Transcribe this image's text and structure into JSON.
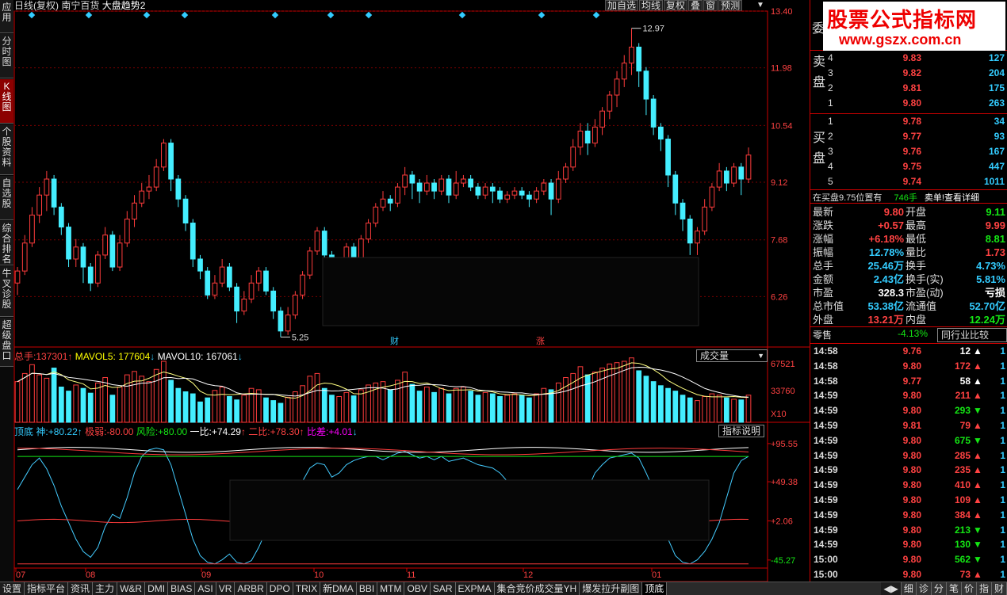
{
  "window": {
    "period": "日线(复权)",
    "stock": "南宁百货",
    "indicator_title": "大盘趋势2"
  },
  "toolbar": [
    "加自选",
    "均线",
    "复权",
    "叠",
    "窗",
    "预测"
  ],
  "left_nav": [
    "应用",
    "分时图",
    "K线图",
    "个股资料",
    "自选股",
    "综合排名",
    "牛叉诊股",
    "超级盘口"
  ],
  "logo": {
    "line1": "股票公式指标网",
    "line2": "www.gszx.com.cn"
  },
  "price_axis": [
    "13.40",
    "11.98",
    "10.54",
    "9.12",
    "7.68",
    "6.26"
  ],
  "markers": {
    "high": "12.97",
    "low": "5.25",
    "cai": "财",
    "zhang": "涨"
  },
  "volume_header": {
    "total_label": "总手:",
    "total": "137301",
    "mavol5_label": "MAVOL5:",
    "mavol5": "177604",
    "mavol10_label": "MAVOL10:",
    "mavol10": "167061",
    "selector": "成交量"
  },
  "volume_axis": [
    "67521",
    "33760",
    "X10"
  ],
  "indicator_header": {
    "name": "顶底",
    "l1": "神:",
    "v1": "+80.22",
    "l2": "极弱:",
    "v2": "-80.00",
    "l3": "风险:",
    "v3": "+80.00",
    "l4": "一比:",
    "v4": "+74.29",
    "l5": "二比:",
    "v5": "+78.30",
    "l6": "比差:",
    "v6": "+4.01",
    "button": "指标说明"
  },
  "indicator_axis": [
    "+95.55",
    "+49.38",
    "+2.06",
    "-45.27"
  ],
  "months": [
    "07",
    "08",
    "09",
    "10",
    "11",
    "12",
    "01"
  ],
  "chart_data": {
    "type": "candlestick",
    "price_range": [
      5.0,
      13.4
    ],
    "candles": [
      [
        6.6,
        6.9,
        6.3,
        7.0
      ],
      [
        6.9,
        7.6,
        6.8,
        7.8
      ],
      [
        7.6,
        8.3,
        7.5,
        8.5
      ],
      [
        8.3,
        8.8,
        8.1,
        9.0
      ],
      [
        8.8,
        9.2,
        8.4,
        9.4
      ],
      [
        9.2,
        8.5,
        8.3,
        9.3
      ],
      [
        8.5,
        8.0,
        7.8,
        8.6
      ],
      [
        8.0,
        7.2,
        7.0,
        8.1
      ],
      [
        7.2,
        7.5,
        7.0,
        7.7
      ],
      [
        7.5,
        7.0,
        6.6,
        7.6
      ],
      [
        7.0,
        6.6,
        6.4,
        7.1
      ],
      [
        6.6,
        7.3,
        6.5,
        7.4
      ],
      [
        7.3,
        7.8,
        7.2,
        8.0
      ],
      [
        7.8,
        7.0,
        6.9,
        7.9
      ],
      [
        7.0,
        7.6,
        6.9,
        7.8
      ],
      [
        7.6,
        8.2,
        7.5,
        8.4
      ],
      [
        8.2,
        8.6,
        8.0,
        8.8
      ],
      [
        8.6,
        8.9,
        8.5,
        9.1
      ],
      [
        8.9,
        9.0,
        8.7,
        9.3
      ],
      [
        9.0,
        9.5,
        8.9,
        9.7
      ],
      [
        9.5,
        10.1,
        9.4,
        10.2
      ],
      [
        10.1,
        9.2,
        8.9,
        10.2
      ],
      [
        9.2,
        8.7,
        8.5,
        9.3
      ],
      [
        8.7,
        8.1,
        7.9,
        8.8
      ],
      [
        8.1,
        7.2,
        7.0,
        8.2
      ],
      [
        7.2,
        6.9,
        6.7,
        7.3
      ],
      [
        6.9,
        6.3,
        6.2,
        7.0
      ],
      [
        6.3,
        6.6,
        6.2,
        6.8
      ],
      [
        6.6,
        7.0,
        6.5,
        7.2
      ],
      [
        7.0,
        6.5,
        6.4,
        7.1
      ],
      [
        6.5,
        5.9,
        5.6,
        6.6
      ],
      [
        5.9,
        6.2,
        5.8,
        6.4
      ],
      [
        6.2,
        6.6,
        6.1,
        6.8
      ],
      [
        6.6,
        6.9,
        6.4,
        7.0
      ],
      [
        6.9,
        6.4,
        6.3,
        7.0
      ],
      [
        6.4,
        5.9,
        5.7,
        6.5
      ],
      [
        5.9,
        5.4,
        5.25,
        6.0
      ],
      [
        5.4,
        5.8,
        5.3,
        6.0
      ],
      [
        5.8,
        6.3,
        5.7,
        6.4
      ],
      [
        6.3,
        6.8,
        6.2,
        6.9
      ],
      [
        6.8,
        7.4,
        6.7,
        7.5
      ],
      [
        7.4,
        7.9,
        7.3,
        8.0
      ],
      [
        7.9,
        7.3,
        7.0,
        8.0
      ],
      [
        7.3,
        7.0,
        6.9,
        7.4
      ],
      [
        7.0,
        7.1,
        6.7,
        7.2
      ],
      [
        7.1,
        7.5,
        7.0,
        7.6
      ],
      [
        7.5,
        7.2,
        7.1,
        7.6
      ],
      [
        7.2,
        7.7,
        7.1,
        7.8
      ],
      [
        7.7,
        8.1,
        7.6,
        8.2
      ],
      [
        8.1,
        8.5,
        8.0,
        8.6
      ],
      [
        8.5,
        8.7,
        8.4,
        8.9
      ],
      [
        8.7,
        8.6,
        8.4,
        8.8
      ],
      [
        8.6,
        9.0,
        8.5,
        9.1
      ],
      [
        9.0,
        9.3,
        8.8,
        9.5
      ],
      [
        9.3,
        9.1,
        8.7,
        9.4
      ],
      [
        9.1,
        8.9,
        8.6,
        9.2
      ],
      [
        8.9,
        9.1,
        8.8,
        9.3
      ],
      [
        9.1,
        8.9,
        8.7,
        9.2
      ],
      [
        8.9,
        9.2,
        8.8,
        9.3
      ],
      [
        9.2,
        8.8,
        8.6,
        9.3
      ],
      [
        8.8,
        9.1,
        8.7,
        9.4
      ],
      [
        9.1,
        9.2,
        9.0,
        9.3
      ],
      [
        9.2,
        9.0,
        8.9,
        9.3
      ],
      [
        9.0,
        8.8,
        8.7,
        9.1
      ],
      [
        8.8,
        9.0,
        8.7,
        9.1
      ],
      [
        9.0,
        8.9,
        8.6,
        9.1
      ],
      [
        8.9,
        8.7,
        8.6,
        9.0
      ],
      [
        8.7,
        8.8,
        8.6,
        8.9
      ],
      [
        8.8,
        8.9,
        8.7,
        9.0
      ],
      [
        8.9,
        8.8,
        8.7,
        9.0
      ],
      [
        8.8,
        8.7,
        8.5,
        8.9
      ],
      [
        8.7,
        8.9,
        8.6,
        9.0
      ],
      [
        8.9,
        9.1,
        8.8,
        9.2
      ],
      [
        9.1,
        8.7,
        8.3,
        9.2
      ],
      [
        8.7,
        9.2,
        8.6,
        9.4
      ],
      [
        9.2,
        9.5,
        9.1,
        9.6
      ],
      [
        9.5,
        10.0,
        9.4,
        10.2
      ],
      [
        10.0,
        10.4,
        9.8,
        10.6
      ],
      [
        10.4,
        10.1,
        9.8,
        10.6
      ],
      [
        10.1,
        10.5,
        10.0,
        10.7
      ],
      [
        10.5,
        10.9,
        10.3,
        11.0
      ],
      [
        10.9,
        11.3,
        10.7,
        11.4
      ],
      [
        11.3,
        11.7,
        11.0,
        11.9
      ],
      [
        11.7,
        12.1,
        11.5,
        12.3
      ],
      [
        12.1,
        12.5,
        11.8,
        12.97
      ],
      [
        12.5,
        11.9,
        11.5,
        12.6
      ],
      [
        11.9,
        11.2,
        10.8,
        12.0
      ],
      [
        11.2,
        10.5,
        10.3,
        11.3
      ],
      [
        10.5,
        10.2,
        9.9,
        10.6
      ],
      [
        10.2,
        9.3,
        9.0,
        10.3
      ],
      [
        9.3,
        8.6,
        8.3,
        9.4
      ],
      [
        8.6,
        8.2,
        7.9,
        8.7
      ],
      [
        8.2,
        7.6,
        7.3,
        8.3
      ],
      [
        7.6,
        7.9,
        7.3,
        8.0
      ],
      [
        7.9,
        8.5,
        7.8,
        8.7
      ],
      [
        8.5,
        9.0,
        8.4,
        9.1
      ],
      [
        9.0,
        9.4,
        8.9,
        9.6
      ],
      [
        9.4,
        9.1,
        8.9,
        9.5
      ],
      [
        9.1,
        9.5,
        9.0,
        9.6
      ],
      [
        9.5,
        9.2,
        8.8,
        9.6
      ],
      [
        9.2,
        9.8,
        9.1,
        9.99
      ]
    ],
    "volume_range": [
      0,
      90000
    ],
    "volumes": [
      60000,
      72000,
      85000,
      70000,
      65000,
      80000,
      52000,
      46000,
      55000,
      50000,
      43000,
      58000,
      66000,
      40000,
      52000,
      70000,
      75000,
      68000,
      60000,
      78000,
      90000,
      62000,
      50000,
      45000,
      42000,
      30000,
      36000,
      47000,
      52000,
      38000,
      33000,
      40000,
      50000,
      48000,
      36000,
      32000,
      28000,
      37000,
      45000,
      54000,
      68000,
      72000,
      50000,
      40000,
      38000,
      44000,
      39000,
      48000,
      55000,
      58000,
      60000,
      48000,
      62000,
      74000,
      56000,
      46000,
      52000,
      44000,
      50000,
      42000,
      50000,
      52000,
      46000,
      40000,
      44000,
      42000,
      38000,
      40000,
      42000,
      40000,
      36000,
      42000,
      50000,
      48000,
      58000,
      66000,
      72000,
      82000,
      70000,
      74000,
      80000,
      86000,
      88000,
      90000,
      95000,
      76000,
      68000,
      60000,
      54000,
      50000,
      46000,
      40000,
      36000,
      32000,
      38000,
      42000,
      40000,
      36000,
      34000,
      33000,
      40000
    ],
    "indicator_range": [
      -55,
      105
    ],
    "series": [
      {
        "name": "神",
        "values": [
          40,
          55,
          70,
          78,
          65,
          45,
          20,
          0,
          -20,
          -35,
          -42,
          -30,
          -5,
          10,
          5,
          30,
          60,
          80,
          88,
          90,
          88,
          70,
          40,
          10,
          -20,
          -40,
          -48,
          -50,
          -45,
          -38,
          -48,
          -50,
          -46,
          -30,
          -10,
          0,
          -4,
          10,
          30,
          50,
          66,
          72,
          70,
          55,
          60,
          70,
          75,
          78,
          80,
          80,
          76,
          80,
          84,
          86,
          82,
          78,
          80,
          76,
          80,
          74,
          76,
          78,
          74,
          70,
          68,
          66,
          60,
          50,
          40,
          30,
          20,
          10,
          0,
          -8,
          -12,
          -10,
          0,
          20,
          40,
          60,
          70,
          78,
          80,
          82,
          84,
          78,
          60,
          40,
          10,
          -20,
          -40,
          -48,
          -50,
          -45,
          -35,
          -20,
          0,
          30,
          60,
          75,
          80
        ]
      },
      {
        "name": "风险",
        "values": [
          80
        ]
      },
      {
        "name": "极弱",
        "values": [
          -50
        ]
      }
    ]
  },
  "order_book": {
    "title": "委",
    "sell_label": "卖盘",
    "buy_label": "买盘",
    "sells": [
      {
        "n": "4",
        "price": "9.83",
        "vol": "127"
      },
      {
        "n": "3",
        "price": "9.82",
        "vol": "204"
      },
      {
        "n": "2",
        "price": "9.81",
        "vol": "175"
      },
      {
        "n": "1",
        "price": "9.80",
        "vol": "263"
      }
    ],
    "buys": [
      {
        "n": "1",
        "price": "9.78",
        "vol": "34"
      },
      {
        "n": "2",
        "price": "9.77",
        "vol": "93"
      },
      {
        "n": "3",
        "price": "9.76",
        "vol": "167"
      },
      {
        "n": "4",
        "price": "9.75",
        "vol": "447"
      },
      {
        "n": "5",
        "price": "9.74",
        "vol": "1011"
      }
    ]
  },
  "notice": {
    "text": "在买盘9.75位置有",
    "count": "746手",
    "tail": "卖单!查看详细"
  },
  "quote": [
    {
      "l1": "最新",
      "v1": "9.80",
      "c1": "red",
      "l2": "开盘",
      "v2": "9.11",
      "c2": "green"
    },
    {
      "l1": "涨跌",
      "v1": "+0.57",
      "c1": "red",
      "l2": "最高",
      "v2": "9.99",
      "c2": "red"
    },
    {
      "l1": "涨幅",
      "v1": "+6.18%",
      "c1": "red",
      "l2": "最低",
      "v2": "8.81",
      "c2": "green"
    },
    {
      "l1": "振幅",
      "v1": "12.78%",
      "c1": "cyan",
      "l2": "量比",
      "v2": "1.73",
      "c2": "red"
    },
    {
      "l1": "总手",
      "v1": "25.46万",
      "c1": "cyan",
      "l2": "换手",
      "v2": "4.73%",
      "c2": "cyan"
    },
    {
      "l1": "金额",
      "v1": "2.43亿",
      "c1": "cyan",
      "l2": "换手(实)",
      "v2": "5.81%",
      "c2": "cyan"
    },
    {
      "l1": "市盈",
      "v1": "328.3",
      "c1": "white",
      "l2": "市盈(动)",
      "v2": "亏损",
      "c2": "white"
    },
    {
      "l1": "总市值",
      "v1": "53.38亿",
      "c1": "cyan",
      "l2": "流通值",
      "v2": "52.70亿",
      "c2": "cyan"
    },
    {
      "l1": "外盘",
      "v1": "13.21万",
      "c1": "red",
      "l2": "内盘",
      "v2": "12.24万",
      "c2": "green"
    }
  ],
  "sector": {
    "name": "零售",
    "change": "-4.13%",
    "button": "同行业比较"
  },
  "trades": [
    {
      "t": "14:58",
      "p": "9.76",
      "pc": "red",
      "v": "12",
      "vc": "white",
      "d": "up-w",
      "c": "1"
    },
    {
      "t": "14:58",
      "p": "9.80",
      "pc": "red",
      "v": "172",
      "vc": "red",
      "d": "up",
      "c": "1"
    },
    {
      "t": "14:58",
      "p": "9.77",
      "pc": "red",
      "v": "58",
      "vc": "white",
      "d": "up-w",
      "c": "1"
    },
    {
      "t": "14:59",
      "p": "9.80",
      "pc": "red",
      "v": "211",
      "vc": "red",
      "d": "up",
      "c": "1"
    },
    {
      "t": "14:59",
      "p": "9.80",
      "pc": "red",
      "v": "293",
      "vc": "green",
      "d": "down",
      "c": "1"
    },
    {
      "t": "14:59",
      "p": "9.81",
      "pc": "red",
      "v": "79",
      "vc": "red",
      "d": "up",
      "c": "1"
    },
    {
      "t": "14:59",
      "p": "9.80",
      "pc": "red",
      "v": "675",
      "vc": "green",
      "d": "down",
      "c": "1"
    },
    {
      "t": "14:59",
      "p": "9.80",
      "pc": "red",
      "v": "285",
      "vc": "red",
      "d": "up",
      "c": "1"
    },
    {
      "t": "14:59",
      "p": "9.80",
      "pc": "red",
      "v": "235",
      "vc": "red",
      "d": "up",
      "c": "1"
    },
    {
      "t": "14:59",
      "p": "9.80",
      "pc": "red",
      "v": "410",
      "vc": "red",
      "d": "up",
      "c": "1"
    },
    {
      "t": "14:59",
      "p": "9.80",
      "pc": "red",
      "v": "109",
      "vc": "red",
      "d": "up",
      "c": "1"
    },
    {
      "t": "14:59",
      "p": "9.80",
      "pc": "red",
      "v": "384",
      "vc": "red",
      "d": "up",
      "c": "1"
    },
    {
      "t": "14:59",
      "p": "9.80",
      "pc": "red",
      "v": "213",
      "vc": "green",
      "d": "down",
      "c": "1"
    },
    {
      "t": "14:59",
      "p": "9.80",
      "pc": "red",
      "v": "130",
      "vc": "green",
      "d": "down",
      "c": "1"
    },
    {
      "t": "15:00",
      "p": "9.80",
      "pc": "red",
      "v": "562",
      "vc": "green",
      "d": "down",
      "c": "1"
    },
    {
      "t": "15:00",
      "p": "9.80",
      "pc": "red",
      "v": "73",
      "vc": "red",
      "d": "up",
      "c": "1"
    }
  ],
  "bottom_tabs": [
    "设置",
    "指标平台",
    "资讯",
    "主力",
    "W&R",
    "DMI",
    "BIAS",
    "ASI",
    "VR",
    "ARBR",
    "DPO",
    "TRIX",
    "新DMA",
    "BBI",
    "MTM",
    "OBV",
    "SAR",
    "EXPMA",
    "集合竞价成交量YH",
    "爆发拉升副图",
    "顶底"
  ],
  "right_tabs": [
    "细",
    "诊",
    "分",
    "笔",
    "价",
    "指",
    "财"
  ]
}
